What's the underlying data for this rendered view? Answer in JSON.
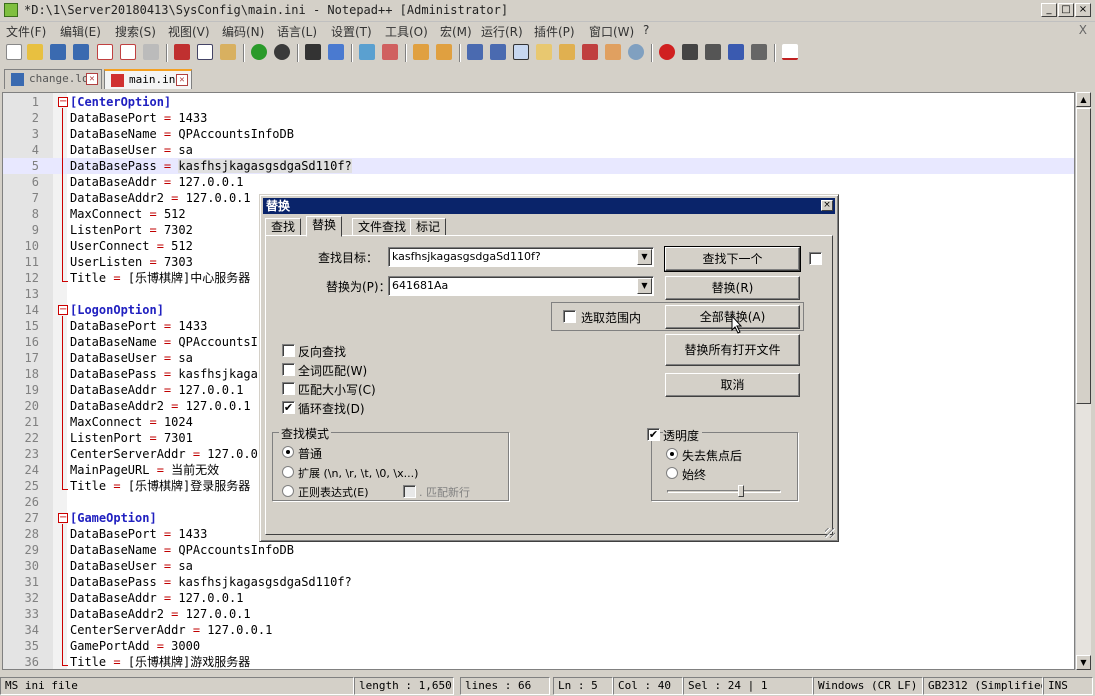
{
  "window": {
    "title": "*D:\\1\\Server20180413\\SysConfig\\main.ini - Notepad++ [Administrator]",
    "minimize": "_",
    "maximize": "□",
    "close": "×"
  },
  "menu": {
    "items": [
      "文件(F)",
      "编辑(E)",
      "搜索(S)",
      "视图(V)",
      "编码(N)",
      "语言(L)",
      "设置(T)",
      "工具(O)",
      "宏(M)",
      "运行(R)",
      "插件(P)",
      "窗口(W)",
      "?"
    ],
    "close": "X"
  },
  "tabs": [
    {
      "label": "change.log",
      "active": false
    },
    {
      "label": "main.ini",
      "active": true
    }
  ],
  "editor": {
    "lines": [
      {
        "n": "1",
        "text": "[CenterOption]",
        "section": true,
        "fold": "open"
      },
      {
        "n": "2",
        "key": "DataBasePort",
        "value": "1433"
      },
      {
        "n": "3",
        "key": "DataBaseName",
        "value": "QPAccountsInfoDB"
      },
      {
        "n": "4",
        "key": "DataBaseUser",
        "value": "sa"
      },
      {
        "n": "5",
        "key": "DataBasePass",
        "value": "kasfhsjkagasgsdgaSd110f?",
        "current": true,
        "highlight": true
      },
      {
        "n": "6",
        "key": "DataBaseAddr",
        "value": "127.0.0.1"
      },
      {
        "n": "7",
        "key": "DataBaseAddr2",
        "value": "127.0.0.1"
      },
      {
        "n": "8",
        "key": "MaxConnect",
        "value": "512"
      },
      {
        "n": "9",
        "key": "ListenPort",
        "value": "7302"
      },
      {
        "n": "10",
        "key": "UserConnect",
        "value": "512"
      },
      {
        "n": "11",
        "key": "UserListen",
        "value": "7303"
      },
      {
        "n": "12",
        "key": "Title",
        "value": "[乐博棋牌]中心服务器"
      },
      {
        "n": "13",
        "text": ""
      },
      {
        "n": "14",
        "text": "[LogonOption]",
        "section": true,
        "fold": "open"
      },
      {
        "n": "15",
        "key": "DataBasePort",
        "value": "1433"
      },
      {
        "n": "16",
        "key": "DataBaseName",
        "value": "QPAccountsInfoDB"
      },
      {
        "n": "17",
        "key": "DataBaseUser",
        "value": "sa"
      },
      {
        "n": "18",
        "key": "DataBasePass",
        "value": "kasfhsjkagasgsdgaSd110f?"
      },
      {
        "n": "19",
        "key": "DataBaseAddr",
        "value": "127.0.0.1"
      },
      {
        "n": "20",
        "key": "DataBaseAddr2",
        "value": "127.0.0.1"
      },
      {
        "n": "21",
        "key": "MaxConnect",
        "value": "1024"
      },
      {
        "n": "22",
        "key": "ListenPort",
        "value": "7301"
      },
      {
        "n": "23",
        "key": "CenterServerAddr",
        "value": "127.0.0.1"
      },
      {
        "n": "24",
        "key": "MainPageURL",
        "value": "当前无效"
      },
      {
        "n": "25",
        "key": "Title",
        "value": "[乐博棋牌]登录服务器"
      },
      {
        "n": "26",
        "text": ""
      },
      {
        "n": "27",
        "text": "[GameOption]",
        "section": true,
        "fold": "open"
      },
      {
        "n": "28",
        "key": "DataBasePort",
        "value": "1433"
      },
      {
        "n": "29",
        "key": "DataBaseName",
        "value": "QPAccountsInfoDB"
      },
      {
        "n": "30",
        "key": "DataBaseUser",
        "value": "sa"
      },
      {
        "n": "31",
        "key": "DataBasePass",
        "value": "kasfhsjkagasgsdgaSd110f?"
      },
      {
        "n": "32",
        "key": "DataBaseAddr",
        "value": "127.0.0.1"
      },
      {
        "n": "33",
        "key": "DataBaseAddr2",
        "value": "127.0.0.1"
      },
      {
        "n": "34",
        "key": "CenterServerAddr",
        "value": "127.0.0.1"
      },
      {
        "n": "35",
        "key": "GamePortAdd",
        "value": "3000"
      },
      {
        "n": "36",
        "key": "Title",
        "value": "[乐博棋牌]游戏服务器"
      }
    ]
  },
  "status": {
    "filetype": "MS ini file",
    "length": "length : 1,650",
    "lines": "lines : 66",
    "ln": "Ln : 5",
    "col": "Col : 40",
    "sel": "Sel : 24 | 1",
    "eol": "Windows (CR LF)",
    "encoding": "GB2312 (Simplified)",
    "mode": "INS"
  },
  "dialog": {
    "title": "替换",
    "close": "×",
    "tabs": [
      "查找",
      "替换",
      "文件查找",
      "标记"
    ],
    "active_tab": "替换",
    "find_label": "查找目标：",
    "find_value": "kasfhsjkagasgsdgaSd110f?",
    "replace_label": "替换为(P)：",
    "replace_value": "641681Aa",
    "buttons": {
      "find_next": "查找下一个",
      "replace": "替换(R)",
      "replace_all": "全部替换(A)",
      "replace_all_open": "替换所有打开文件",
      "cancel": "取消"
    },
    "in_selection": "选取范围内",
    "options": [
      {
        "label": "反向查找",
        "checked": false
      },
      {
        "label": "全词匹配(W)",
        "checked": false
      },
      {
        "label": "匹配大小写(C)",
        "checked": false
      },
      {
        "label": "循环查找(D)",
        "checked": true
      }
    ],
    "search_mode": {
      "title": "查找模式",
      "options": [
        {
          "label": "普通",
          "selected": true
        },
        {
          "label": "扩展 (\\n, \\r, \\t, \\0, \\x...)",
          "selected": false
        },
        {
          "label": "正则表达式(E)",
          "selected": false
        }
      ],
      "dot_newline": ". 匹配新行"
    },
    "transparency": {
      "title": "透明度",
      "checked": true,
      "options": [
        {
          "label": "失去焦点后",
          "selected": true
        },
        {
          "label": "始终",
          "selected": false
        }
      ],
      "level": 0.65
    }
  },
  "colors": {
    "section": "#2020c0",
    "equals": "#c00000",
    "dialog_title_bg": "#0a246a",
    "current_line": "#e8e8ff",
    "active_tab_accent": "#f5a020"
  }
}
